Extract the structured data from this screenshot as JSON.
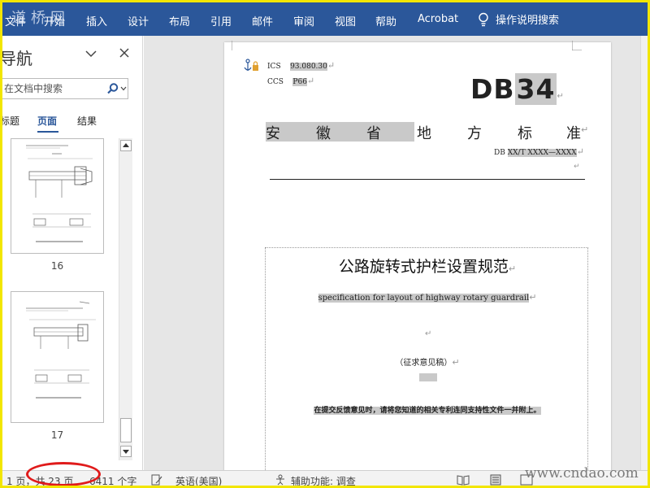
{
  "watermark": "道桥网",
  "ribbon": {
    "tabs": [
      "文件",
      "开始",
      "插入",
      "设计",
      "布局",
      "引用",
      "邮件",
      "审阅",
      "视图",
      "帮助",
      "Acrobat"
    ],
    "tell_me": "操作说明搜索"
  },
  "nav": {
    "title": "导航",
    "search_placeholder": "在文档中搜索",
    "tabs": [
      "标题",
      "页面",
      "结果"
    ],
    "active_tab": "页面",
    "pages": [
      "16",
      "17"
    ]
  },
  "document": {
    "ics_label": "ICS",
    "ics_value": "93.080.30",
    "ccs_label": "CCS",
    "ccs_value": "P66",
    "db_prefix": "DB",
    "db_number": "34",
    "province_chars": [
      "安",
      "徽",
      "省",
      "地",
      "方",
      "标",
      "准"
    ],
    "std_prefix": "DB",
    "std_number": "XX/T XXXX—XXXX",
    "title_cn": "公路旋转式护栏设置规范",
    "title_en": "specification for layout of highway rotary guardrail",
    "draft": "（征求意见稿）",
    "notice": "在提交反馈意见时，请将您知道的相关专利连同支持性文件一并附上。",
    "return_mark": "↵"
  },
  "status": {
    "page": "1 页，共 23 页",
    "words": "6411 个字",
    "language": "英语(美国)",
    "accessibility": "辅助功能: 调查"
  },
  "site_watermark": "www.cndao.com",
  "colors": {
    "ribbon": "#2b579a",
    "frame": "#f2e600",
    "highlight": "#c9c9c9",
    "annotation": "#e01b1b"
  }
}
